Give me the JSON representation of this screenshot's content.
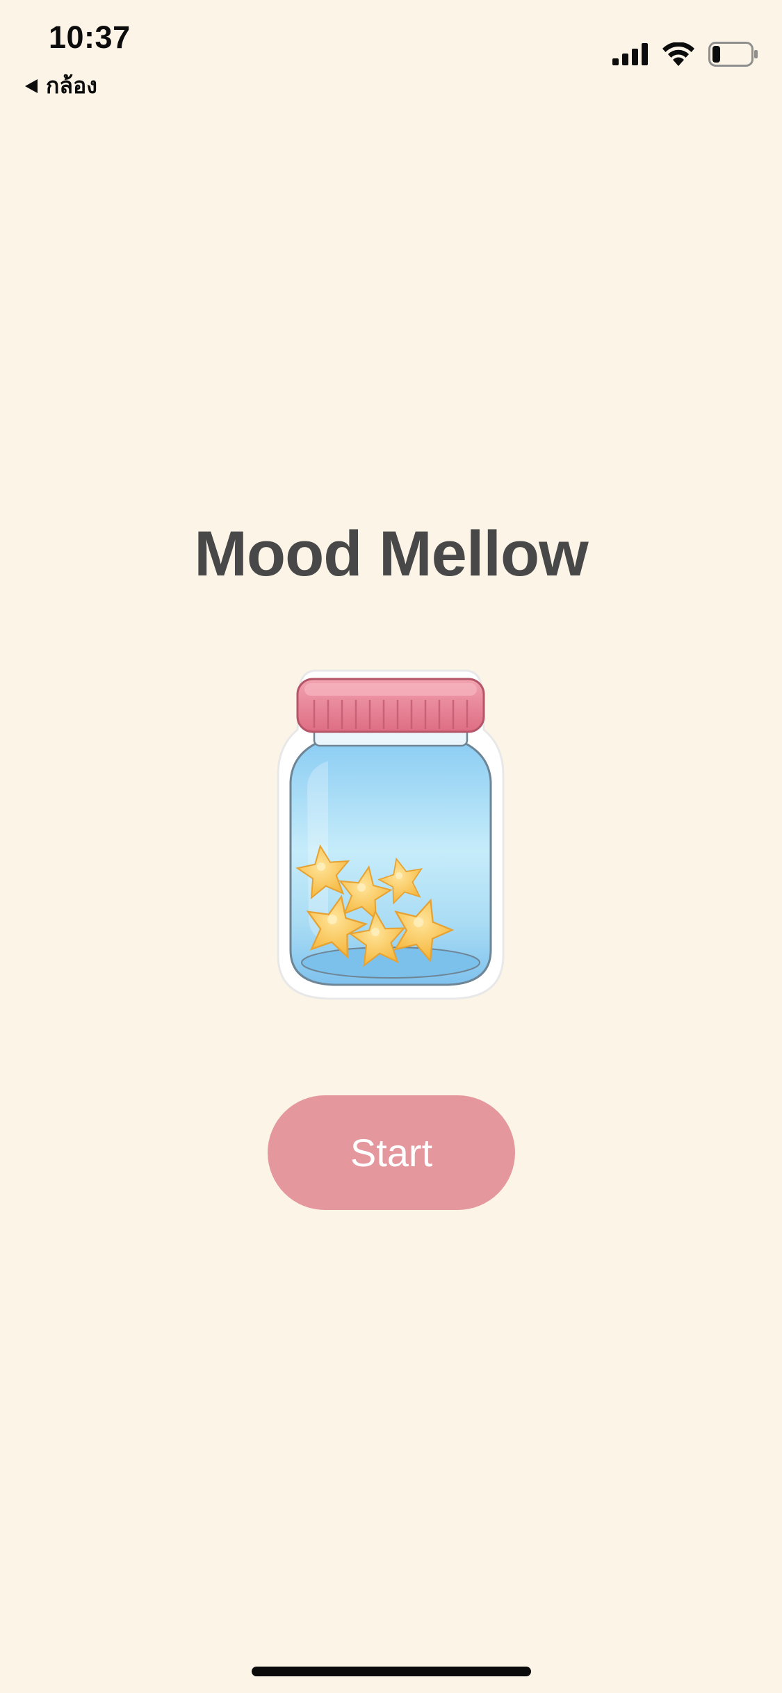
{
  "status_bar": {
    "time": "10:37",
    "back_label": "กล้อง",
    "back_icon": "back-triangle-icon",
    "signal_icon": "cellular-signal-icon",
    "wifi_icon": "wifi-icon",
    "battery_icon": "battery-icon",
    "battery_level": 0.2
  },
  "main": {
    "title": "Mood Mellow",
    "illustration": "star-jar-illustration",
    "start_label": "Start"
  },
  "colors": {
    "background": "#fcf5e7",
    "title_text": "#484848",
    "button": "#e4979c",
    "button_text": "#ffffff",
    "jar_lid": "#e87f92",
    "jar_glass": "#9fd4f2",
    "stars": "#f9c74f"
  }
}
